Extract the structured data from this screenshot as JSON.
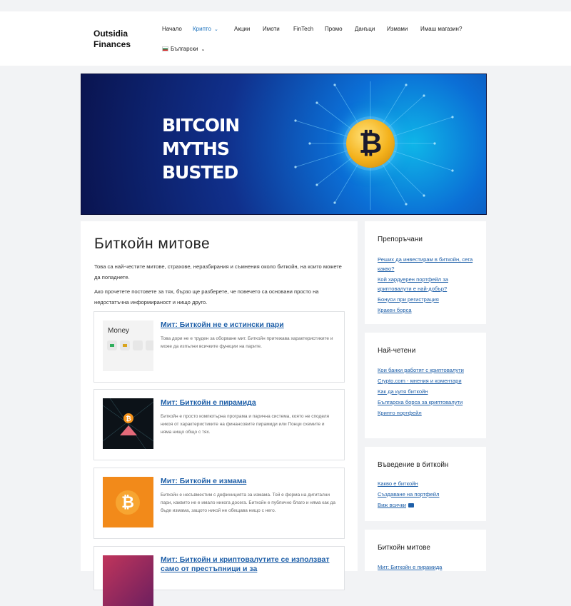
{
  "site": {
    "logo_line1": "Outsidia",
    "logo_line2": "Finances"
  },
  "nav": {
    "items": [
      {
        "label": "Начало"
      },
      {
        "label": "Крипто"
      },
      {
        "label": "Акции"
      },
      {
        "label": "Имоти"
      },
      {
        "label": "FinTech"
      },
      {
        "label": "Промо"
      },
      {
        "label": "Данъци"
      },
      {
        "label": "Измами"
      },
      {
        "label": "Имаш магазин?"
      }
    ],
    "language": "Български"
  },
  "banner": {
    "line1": "BITCOIN",
    "line2": "MYTHS",
    "line3": "BUSTED",
    "coin_symbol": "₿"
  },
  "article": {
    "title": "Биткойн митове",
    "intro1": "Това са най-честите митове, страхове, неразбирания и съмнения около биткойн, на които можете да попаднете.",
    "intro2": "Ако прочетете постовете за тях, бързо ще разберете, че повечето са основани просто на недостатъчна информираност и нищо друго.",
    "cards": [
      {
        "title": "Мит: Биткойн не е истински пари",
        "text": "Това дори не е труден за оборване мит. Биткойн притежава характеристиките и може да изпълни всичките функции на парите.",
        "thumb_label": "Money"
      },
      {
        "title": "Мит: Биткойн е пирамида",
        "text": "Биткойн е просто компютърна програма и парична система, която не споделя никоя от характеристиките на финансовите пирамиди или Понци схемите и няма нищо общо с тях."
      },
      {
        "title": "Мит: Биткойн е измама",
        "text": "Биткойн е несъвместим с дефиницията за измама. Той е форма на дигитални пари, каквито не е имало никога досега. Биткойн е публично благо и няма как да бъде измама, защото никой не обещава нищо с него."
      },
      {
        "title": "Мит: Биткойн и криптовалутите се използват само от престъпници и за",
        "text": ""
      }
    ]
  },
  "sidebar": {
    "recommended": {
      "title": "Препоръчани",
      "links": [
        "Реших да инвестирам в биткойн, сега какво?",
        "Кой хардуерен портфейл за криптовалути е най-добър?",
        "Бонуси при регистрация",
        "Кракен борса"
      ]
    },
    "most_read": {
      "title": "Най-четени",
      "links": [
        "Кои банки работят с криптовалути",
        "Crypto.com - мнения и коментари",
        "Как да купя биткойн",
        "Българска борса за криптовалути",
        "Крипто портфейл"
      ]
    },
    "intro_bitcoin": {
      "title": "Въведение в биткойн",
      "links": [
        "Какво е биткойн",
        "Създаване на портфейл",
        "Виж всички"
      ]
    },
    "bitcoin_myths": {
      "title": "Биткойн митове",
      "links": [
        "Мит: Биткойн е пирамида"
      ]
    }
  },
  "colors": {
    "link": "#1e5fa8",
    "active_nav": "#1e73be",
    "background": "#f2f3f5"
  }
}
